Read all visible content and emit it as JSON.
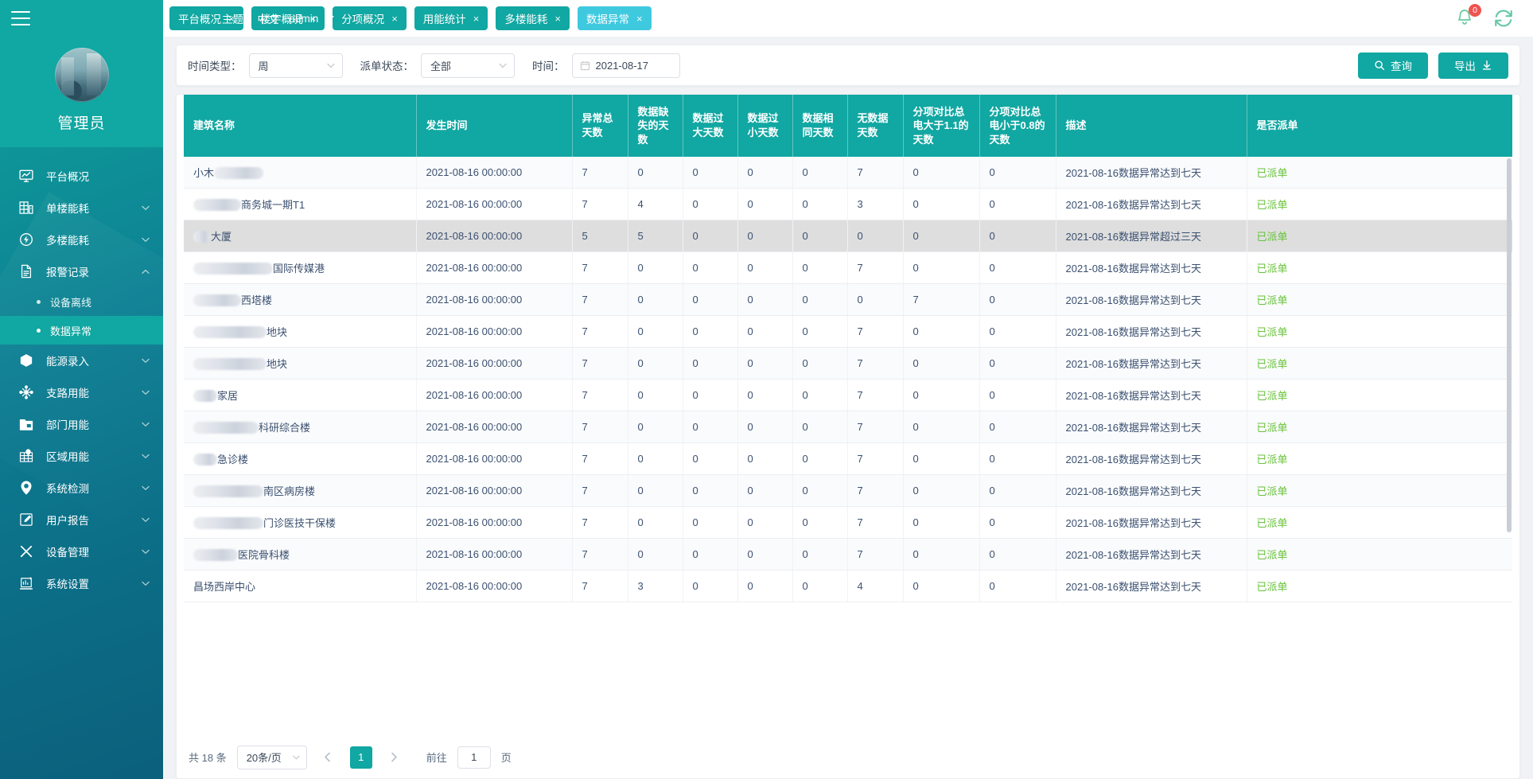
{
  "header": {
    "menu_toggle_icon": "hamburger-icon",
    "theme_label": "主题",
    "separator": "|",
    "language_label": "中文",
    "user_label": "admin",
    "notification_count": "0",
    "bell_icon": "bell-icon",
    "refresh_icon": "refresh-icon",
    "accent_color": "#11a7a2",
    "active_tab_color": "#3fc9df",
    "badge_color": "#ef5350"
  },
  "tabs": [
    {
      "label": "平台概况",
      "close": "×",
      "active": false
    },
    {
      "label": "楼宇概况",
      "close": "×",
      "active": false
    },
    {
      "label": "分项概况",
      "close": "×",
      "active": false
    },
    {
      "label": "用能统计",
      "close": "×",
      "active": false
    },
    {
      "label": "多楼能耗",
      "close": "×",
      "active": false
    },
    {
      "label": "数据异常",
      "close": "×",
      "active": true
    }
  ],
  "sidebar": {
    "username": "管理员",
    "avatar_icon": "avatar-image",
    "items": [
      {
        "label": "平台概况",
        "icon": "monitor-chart-icon",
        "expandable": false
      },
      {
        "label": "单楼能耗",
        "icon": "building-icon",
        "expandable": true
      },
      {
        "label": "多楼能耗",
        "icon": "power-circle-icon",
        "expandable": true
      },
      {
        "label": "报警记录",
        "icon": "document-icon",
        "expandable": true,
        "expanded": true,
        "children": [
          {
            "label": "设备离线",
            "active": false
          },
          {
            "label": "数据异常",
            "active": true
          }
        ]
      },
      {
        "label": "能源录入",
        "icon": "hexagon-icon",
        "expandable": true
      },
      {
        "label": "支路用能",
        "icon": "branch-network-icon",
        "expandable": true
      },
      {
        "label": "部门用能",
        "icon": "folder-icon",
        "expandable": true
      },
      {
        "label": "区域用能",
        "icon": "map-grid-icon",
        "expandable": true
      },
      {
        "label": "系统检测",
        "icon": "location-pin-icon",
        "expandable": true
      },
      {
        "label": "用户报告",
        "icon": "edit-note-icon",
        "expandable": true
      },
      {
        "label": "设备管理",
        "icon": "tools-icon",
        "expandable": true
      },
      {
        "label": "系统设置",
        "icon": "settings-chart-icon",
        "expandable": true
      }
    ]
  },
  "filters": {
    "time_type_label": "时间类型：",
    "time_type_value": "周",
    "dispatch_status_label": "派单状态：",
    "dispatch_status_value": "全部",
    "time_label": "时间：",
    "time_value": "2021-08-17",
    "calendar_icon": "calendar-icon",
    "search_button": "查询",
    "search_icon": "search-icon",
    "export_button": "导出",
    "export_icon": "download-icon"
  },
  "table": {
    "columns": [
      "建筑名称",
      "发生时间",
      "异常总天数",
      "数据缺失的天数",
      "数据过大天数",
      "数据过小天数",
      "数据相同天数",
      "无数据天数",
      "分项对比总电大于1.1的天数",
      "分项对比总电小于0.8的天数",
      "描述",
      "是否派单"
    ],
    "rows": [
      {
        "name_prefix": "小木",
        "redact_w": 62,
        "name_suffix": "",
        "time": "2021-08-16 00:00:00",
        "total": "7",
        "missing": "0",
        "too_big": "0",
        "too_small": "0",
        "same": "0",
        "no_data": "7",
        "gt11": "0",
        "lt08": "0",
        "desc": "2021-08-16数据异常达到七天",
        "dispatch": "已派单",
        "hovered": false
      },
      {
        "name_prefix": "",
        "redact_w": 60,
        "name_suffix": "商务城一期T1",
        "time": "2021-08-16 00:00:00",
        "total": "7",
        "missing": "4",
        "too_big": "0",
        "too_small": "0",
        "same": "0",
        "no_data": "3",
        "gt11": "0",
        "lt08": "0",
        "desc": "2021-08-16数据异常达到七天",
        "dispatch": "已派单",
        "hovered": false
      },
      {
        "name_prefix": "",
        "redact_w": 22,
        "name_suffix": "大厦",
        "time": "2021-08-16 00:00:00",
        "total": "5",
        "missing": "5",
        "too_big": "0",
        "too_small": "0",
        "same": "0",
        "no_data": "0",
        "gt11": "0",
        "lt08": "0",
        "desc": "2021-08-16数据异常超过三天",
        "dispatch": "已派单",
        "hovered": true
      },
      {
        "name_prefix": "",
        "redact_w": 100,
        "name_suffix": "国际传媒港",
        "time": "2021-08-16 00:00:00",
        "total": "7",
        "missing": "0",
        "too_big": "0",
        "too_small": "0",
        "same": "0",
        "no_data": "7",
        "gt11": "0",
        "lt08": "0",
        "desc": "2021-08-16数据异常达到七天",
        "dispatch": "已派单",
        "hovered": false
      },
      {
        "name_prefix": "",
        "redact_w": 60,
        "name_suffix": "西塔楼",
        "time": "2021-08-16 00:00:00",
        "total": "7",
        "missing": "0",
        "too_big": "0",
        "too_small": "0",
        "same": "0",
        "no_data": "0",
        "gt11": "7",
        "lt08": "0",
        "desc": "2021-08-16数据异常达到七天",
        "dispatch": "已派单",
        "hovered": false
      },
      {
        "name_prefix": "",
        "redact_w": 92,
        "name_suffix": "地块",
        "time": "2021-08-16 00:00:00",
        "total": "7",
        "missing": "0",
        "too_big": "0",
        "too_small": "0",
        "same": "0",
        "no_data": "7",
        "gt11": "0",
        "lt08": "0",
        "desc": "2021-08-16数据异常达到七天",
        "dispatch": "已派单",
        "hovered": false
      },
      {
        "name_prefix": "",
        "redact_w": 92,
        "name_suffix": "地块",
        "time": "2021-08-16 00:00:00",
        "total": "7",
        "missing": "0",
        "too_big": "0",
        "too_small": "0",
        "same": "0",
        "no_data": "7",
        "gt11": "0",
        "lt08": "0",
        "desc": "2021-08-16数据异常达到七天",
        "dispatch": "已派单",
        "hovered": false
      },
      {
        "name_prefix": "",
        "redact_w": 30,
        "name_suffix": "家居",
        "time": "2021-08-16 00:00:00",
        "total": "7",
        "missing": "0",
        "too_big": "0",
        "too_small": "0",
        "same": "0",
        "no_data": "7",
        "gt11": "0",
        "lt08": "0",
        "desc": "2021-08-16数据异常达到七天",
        "dispatch": "已派单",
        "hovered": false
      },
      {
        "name_prefix": "",
        "redact_w": 82,
        "name_suffix": "科研综合楼",
        "time": "2021-08-16 00:00:00",
        "total": "7",
        "missing": "0",
        "too_big": "0",
        "too_small": "0",
        "same": "0",
        "no_data": "7",
        "gt11": "0",
        "lt08": "0",
        "desc": "2021-08-16数据异常达到七天",
        "dispatch": "已派单",
        "hovered": false
      },
      {
        "name_prefix": "",
        "redact_w": 30,
        "name_suffix": "急诊楼",
        "time": "2021-08-16 00:00:00",
        "total": "7",
        "missing": "0",
        "too_big": "0",
        "too_small": "0",
        "same": "0",
        "no_data": "7",
        "gt11": "0",
        "lt08": "0",
        "desc": "2021-08-16数据异常达到七天",
        "dispatch": "已派单",
        "hovered": false
      },
      {
        "name_prefix": "",
        "redact_w": 88,
        "name_suffix": "南区病房楼",
        "time": "2021-08-16 00:00:00",
        "total": "7",
        "missing": "0",
        "too_big": "0",
        "too_small": "0",
        "same": "0",
        "no_data": "7",
        "gt11": "0",
        "lt08": "0",
        "desc": "2021-08-16数据异常达到七天",
        "dispatch": "已派单",
        "hovered": false
      },
      {
        "name_prefix": "",
        "redact_w": 88,
        "name_suffix": "门诊医技干保楼",
        "time": "2021-08-16 00:00:00",
        "total": "7",
        "missing": "0",
        "too_big": "0",
        "too_small": "0",
        "same": "0",
        "no_data": "7",
        "gt11": "0",
        "lt08": "0",
        "desc": "2021-08-16数据异常达到七天",
        "dispatch": "已派单",
        "hovered": false
      },
      {
        "name_prefix": "",
        "redact_w": 56,
        "name_suffix": "医院骨科楼",
        "time": "2021-08-16 00:00:00",
        "total": "7",
        "missing": "0",
        "too_big": "0",
        "too_small": "0",
        "same": "0",
        "no_data": "7",
        "gt11": "0",
        "lt08": "0",
        "desc": "2021-08-16数据异常达到七天",
        "dispatch": "已派单",
        "hovered": false
      },
      {
        "name_prefix": "昌场西岸中心",
        "redact_w": 0,
        "name_suffix": "",
        "time": "2021-08-16 00:00:00",
        "total": "7",
        "missing": "3",
        "too_big": "0",
        "too_small": "0",
        "same": "0",
        "no_data": "4",
        "gt11": "0",
        "lt08": "0",
        "desc": "2021-08-16数据异常达到七天",
        "dispatch": "已派单",
        "hovered": false
      }
    ]
  },
  "pagination": {
    "total_text": "共 18 条",
    "page_size": "20条/页",
    "prev_icon": "chevron-left-icon",
    "next_icon": "chevron-right-icon",
    "current_page": "1",
    "jump_label": "前往",
    "jump_value": "1",
    "page_unit": "页"
  }
}
